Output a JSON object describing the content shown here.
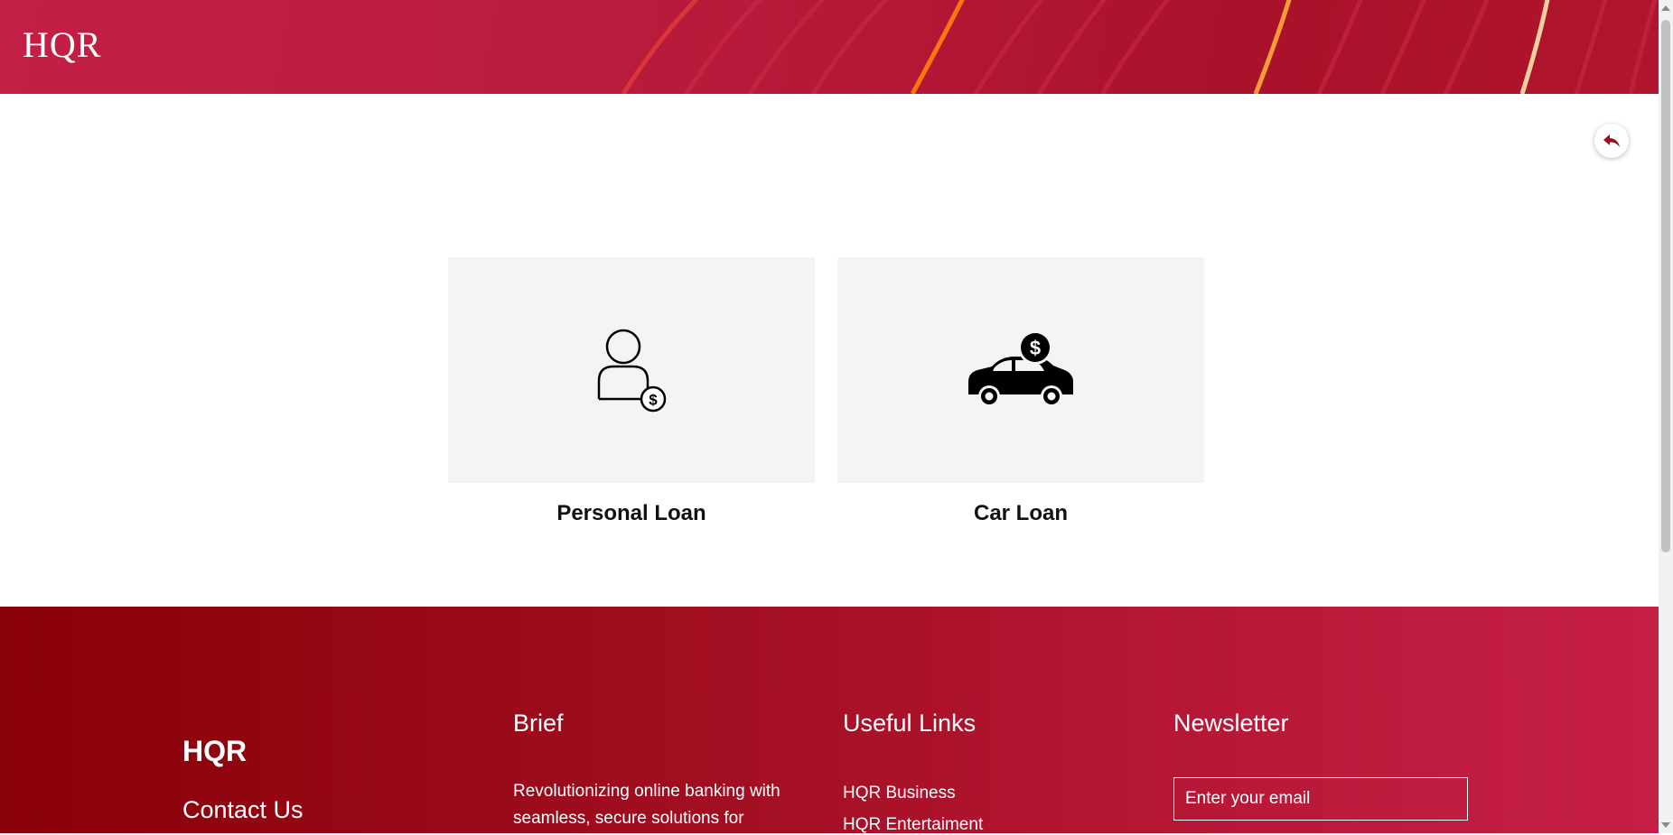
{
  "header": {
    "brand": "HQR"
  },
  "back_button": {
    "icon": "reply-arrow-icon"
  },
  "cards": [
    {
      "label": "Personal Loan",
      "icon": "person-dollar-icon"
    },
    {
      "label": "Car Loan",
      "icon": "car-dollar-icon"
    }
  ],
  "footer": {
    "brand": "HQR",
    "contact": "Contact Us",
    "brief": {
      "heading": "Brief",
      "text": "Revolutionizing online banking with seamless, secure solutions for"
    },
    "useful_links": {
      "heading": "Useful Links",
      "links": [
        "HQR Business",
        "HQR Entertaiment"
      ]
    },
    "newsletter": {
      "heading": "Newsletter",
      "email_placeholder": "Enter your email"
    }
  },
  "colors": {
    "brand_red": "#c41f45",
    "footer_dark": "#880008",
    "accent_dark_red": "#9b0e20"
  }
}
